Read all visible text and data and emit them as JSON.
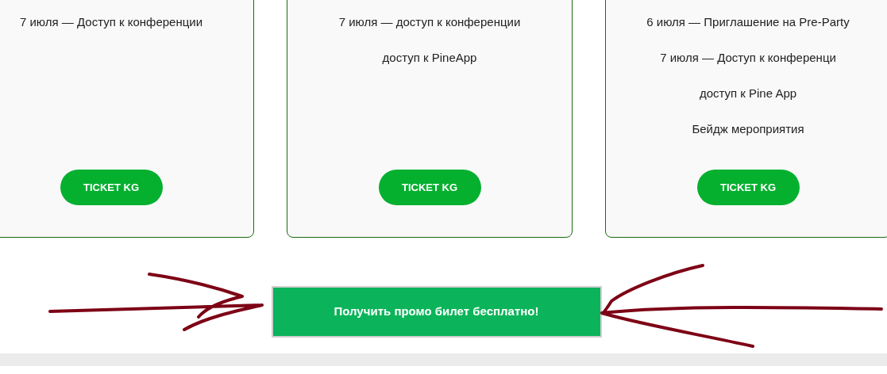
{
  "cards": [
    {
      "lines": [
        "7 июля — Доступ к конференции"
      ],
      "button": "TICKET KG"
    },
    {
      "lines": [
        "7 июля — доступ к конференции",
        "доступ к PineApp"
      ],
      "button": "TICKET KG"
    },
    {
      "lines": [
        "6 июля — Приглашение на Pre-Party",
        "7 июля — Доступ к конференци",
        "доступ к Pine App",
        "Бейдж мероприятия"
      ],
      "button": "TICKET KG"
    }
  ],
  "promo_button": "Получить промо билет бесплатно!"
}
